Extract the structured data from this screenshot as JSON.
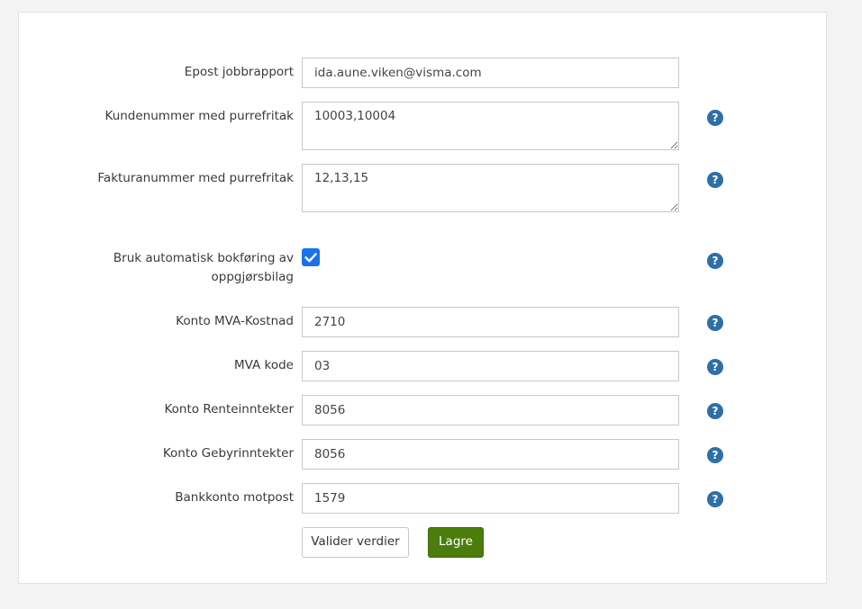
{
  "form": {
    "email_report": {
      "label": "Epost jobbrapport",
      "value": "ida.aune.viken@visma.com"
    },
    "customer_exempt": {
      "label": "Kundenummer med purrefritak",
      "value": "10003,10004"
    },
    "invoice_exempt": {
      "label": "Fakturanummer med purrefritak",
      "value": "12,13,15"
    },
    "auto_booking": {
      "label": "Bruk automatisk bokføring av oppgjørsbilag",
      "checked": true
    },
    "vat_cost_account": {
      "label": "Konto MVA-Kostnad",
      "value": "2710"
    },
    "vat_code": {
      "label": "MVA kode",
      "value": "03"
    },
    "interest_income_account": {
      "label": "Konto Renteinntekter",
      "value": "8056"
    },
    "fee_income_account": {
      "label": "Konto Gebyrinntekter",
      "value": "8056"
    },
    "bank_contra_account": {
      "label": "Bankkonto motpost",
      "value": "1579"
    },
    "help_glyph": "?"
  },
  "actions": {
    "validate_label": "Valider verdier",
    "save_label": "Lagre"
  },
  "colors": {
    "help_icon": "#2e6fa6",
    "checkbox": "#1a73e8",
    "save_button": "#4a7d0c"
  },
  "icons": {
    "help": "question-circle-icon",
    "checkbox": "check-icon"
  }
}
